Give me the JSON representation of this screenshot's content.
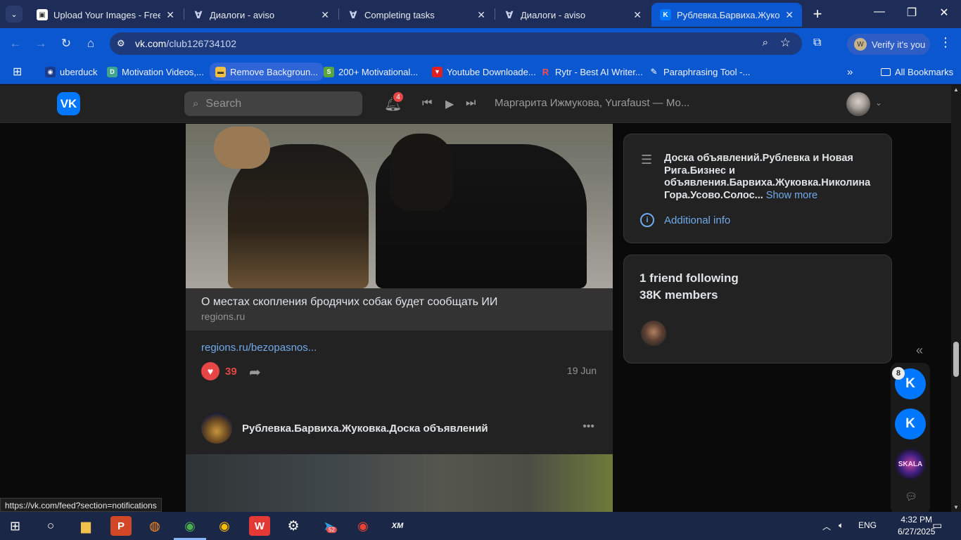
{
  "browser": {
    "tabs": [
      {
        "title": "Upload Your Images - Free I",
        "icon": "image-upload-icon",
        "active": false
      },
      {
        "title": "Диалоги - aviso",
        "icon": "aviso-icon",
        "active": false
      },
      {
        "title": "Completing tasks",
        "icon": "aviso-icon",
        "active": false
      },
      {
        "title": "Диалоги - aviso",
        "icon": "aviso-icon",
        "active": false
      },
      {
        "title": "Рублевка.Барвиха.Жуковка.",
        "icon": "vk-icon",
        "active": true
      }
    ],
    "url_domain": "vk.com",
    "url_path": "/club126734102",
    "profile_label": "Verify it's you",
    "profile_initial": "W",
    "bookmarks": [
      {
        "label": "uberduck",
        "icon": "uberduck-icon"
      },
      {
        "label": "Motivation Videos,...",
        "icon": "motivation-icon"
      },
      {
        "label": "Remove Backgroun...",
        "icon": "remove-bg-icon"
      },
      {
        "label": "200+ Motivational...",
        "icon": "shopify-icon"
      },
      {
        "label": "Youtube Downloade...",
        "icon": "youtube-dl-icon"
      },
      {
        "label": "Rytr - Best AI Writer...",
        "icon": "rytr-icon"
      },
      {
        "label": "Paraphrasing Tool -...",
        "icon": "paraphrase-icon"
      }
    ],
    "all_bookmarks": "All Bookmarks"
  },
  "vk": {
    "logo": "VK",
    "search_placeholder": "Search",
    "notifications_count": "4",
    "now_playing": "Маргарита Ижмукова, Yurafaust — Мо...",
    "post": {
      "link_title": "О местах скопления бродячих собак будет сообщать ИИ",
      "link_domain": "regions.ru",
      "link_text": "regions.ru/bezopasnos...",
      "likes": "39",
      "date": "19 Jun"
    },
    "next_post": {
      "author": "Рублевка.Барвиха.Жуковка.Доска объявлений"
    },
    "about": {
      "description": "Доска объявлений.Рублевка и Новая Рига.Бизнес и объявления.Барвиха.Жуковка.Николина Гора.Усово.Солос...",
      "show_more": "Show more",
      "additional_info": "Additional info"
    },
    "followers": {
      "friends": "1 friend following",
      "members": "38K members"
    },
    "chats": {
      "badge": "8",
      "skala_label": "SKALA"
    }
  },
  "status_url": "https://vk.com/feed?section=notifications",
  "taskbar": {
    "language": "ENG",
    "time": "4:32 PM",
    "date": "6/27/2025",
    "telegram_badge": "52"
  }
}
